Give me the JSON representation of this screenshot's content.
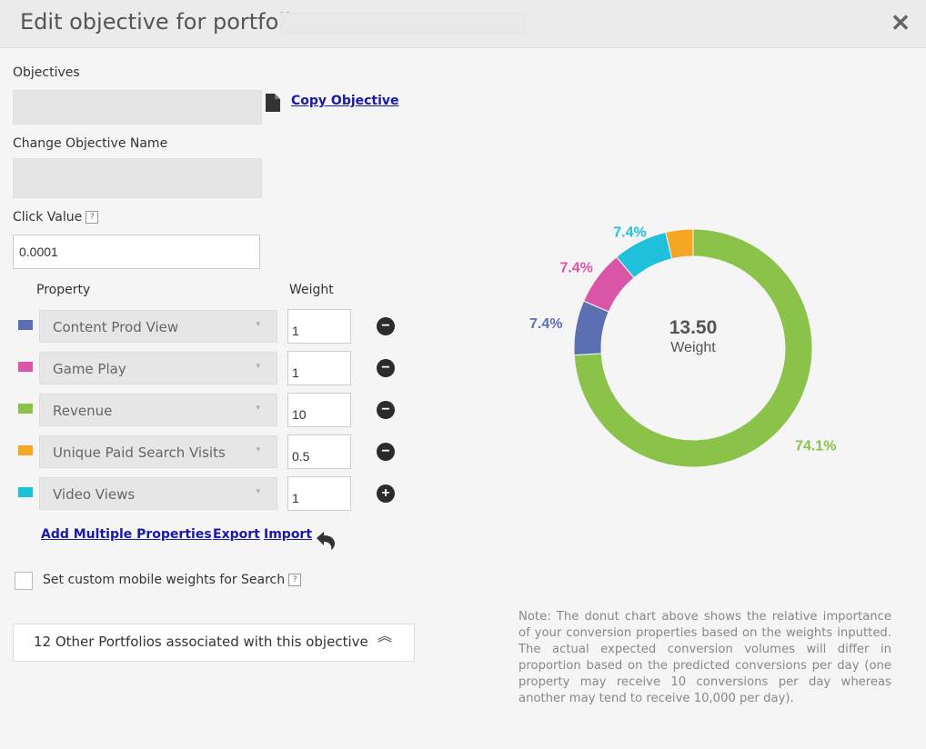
{
  "header": {
    "title": "Edit objective for portfolio",
    "close_icon": "close-icon",
    "close_glyph": "✕"
  },
  "objectives": {
    "label": "Objectives",
    "copy_link": "Copy Objective"
  },
  "change_name": {
    "label": "Change Objective Name"
  },
  "click_value": {
    "label": "Click Value",
    "help": "?",
    "value": "0.0001"
  },
  "properties": {
    "property_header": "Property",
    "weight_header": "Weight",
    "rows": [
      {
        "name": "Content Prod View",
        "weight": "1",
        "color": "#5b6fb2",
        "action": "−"
      },
      {
        "name": "Game Play",
        "weight": "1",
        "color": "#d855a8",
        "action": "−"
      },
      {
        "name": "Revenue",
        "weight": "10",
        "color": "#8bc34a",
        "action": "−"
      },
      {
        "name": "Unique Paid Search Visits",
        "weight": "0.5",
        "color": "#f5a623",
        "action": "−"
      },
      {
        "name": "Video Views",
        "weight": "1",
        "color": "#1ec0db",
        "action": "+"
      }
    ],
    "caret": "▾"
  },
  "actions": {
    "add_multiple": "Add Multiple Properties",
    "export": "Export",
    "import": "Import",
    "undo_icon": "undo-icon"
  },
  "mobile": {
    "label": "Set custom mobile weights for Search",
    "help": "?"
  },
  "others": {
    "label": "12 Other Portfolios associated with this objective",
    "chevron": "︽"
  },
  "chart_data": {
    "type": "pie",
    "donut": true,
    "center_value": "13.50",
    "center_label": "Weight",
    "slices": [
      {
        "name": "Revenue",
        "value": 10,
        "label": "74.1%",
        "color": "#8bc34a"
      },
      {
        "name": "Content Prod View",
        "value": 1,
        "label": "7.4%",
        "color": "#5b6fb2"
      },
      {
        "name": "Game Play",
        "value": 1,
        "label": "7.4%",
        "color": "#d855a8"
      },
      {
        "name": "Video Views",
        "value": 1,
        "label": "7.4%",
        "color": "#1ec0db"
      },
      {
        "name": "Unique Paid Search Visits",
        "value": 0.5,
        "label": "",
        "color": "#f5a623"
      }
    ]
  },
  "note": "Note: The donut chart above shows the relative importance of your conversion properties based on the weights inputted. The actual expected conversion volumes will differ in proportion based on the predicted conversions per day (one property may receive 10 conversions per day whereas another may tend to receive 10,000 per day)."
}
